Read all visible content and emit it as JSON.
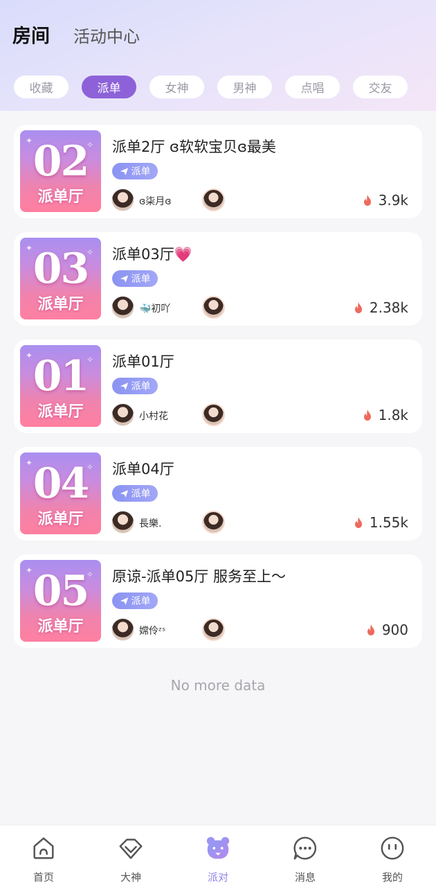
{
  "header": {
    "tab_main": "房间",
    "tab_sub": "活动中心",
    "chips": [
      {
        "label": "收藏",
        "active": false
      },
      {
        "label": "派单",
        "active": true
      },
      {
        "label": "女神",
        "active": false
      },
      {
        "label": "男神",
        "active": false
      },
      {
        "label": "点唱",
        "active": false
      },
      {
        "label": "交友",
        "active": false
      }
    ]
  },
  "rooms": [
    {
      "num": "02",
      "hall": "派单厅",
      "title": "派单2厅 ɞ软软宝贝ɞ最美",
      "badge": "派单",
      "host": "ɞ柒月ɞ",
      "heat": "3.9k"
    },
    {
      "num": "03",
      "hall": "派单厅",
      "title": "派单03厅💗",
      "badge": "派单",
      "host": "🐳初吖",
      "heat": "2.38k"
    },
    {
      "num": "01",
      "hall": "派单厅",
      "title": "派单01厅",
      "badge": "派单",
      "host": "小村花",
      "heat": "1.8k"
    },
    {
      "num": "04",
      "hall": "派单厅",
      "title": "派单04厅",
      "badge": "派单",
      "host": "長樂.",
      "heat": "1.55k"
    },
    {
      "num": "05",
      "hall": "派单厅",
      "title": "原谅-派单05厅 服务至上～",
      "badge": "派单",
      "host": "嫦伶ᶻˢ",
      "heat": "900"
    }
  ],
  "no_more": "No more data",
  "nav": {
    "items": [
      {
        "label": "首页",
        "icon": "home-icon"
      },
      {
        "label": "大神",
        "icon": "heart-diamond-icon"
      },
      {
        "label": "派对",
        "icon": "bear-icon"
      },
      {
        "label": "消息",
        "icon": "chat-icon"
      },
      {
        "label": "我的",
        "icon": "face-icon"
      }
    ],
    "active_color": "#8f86e8"
  },
  "colors": {
    "accent": "#8d62d9",
    "badge": "#8b93f2",
    "fire": "#ee6a5d"
  }
}
